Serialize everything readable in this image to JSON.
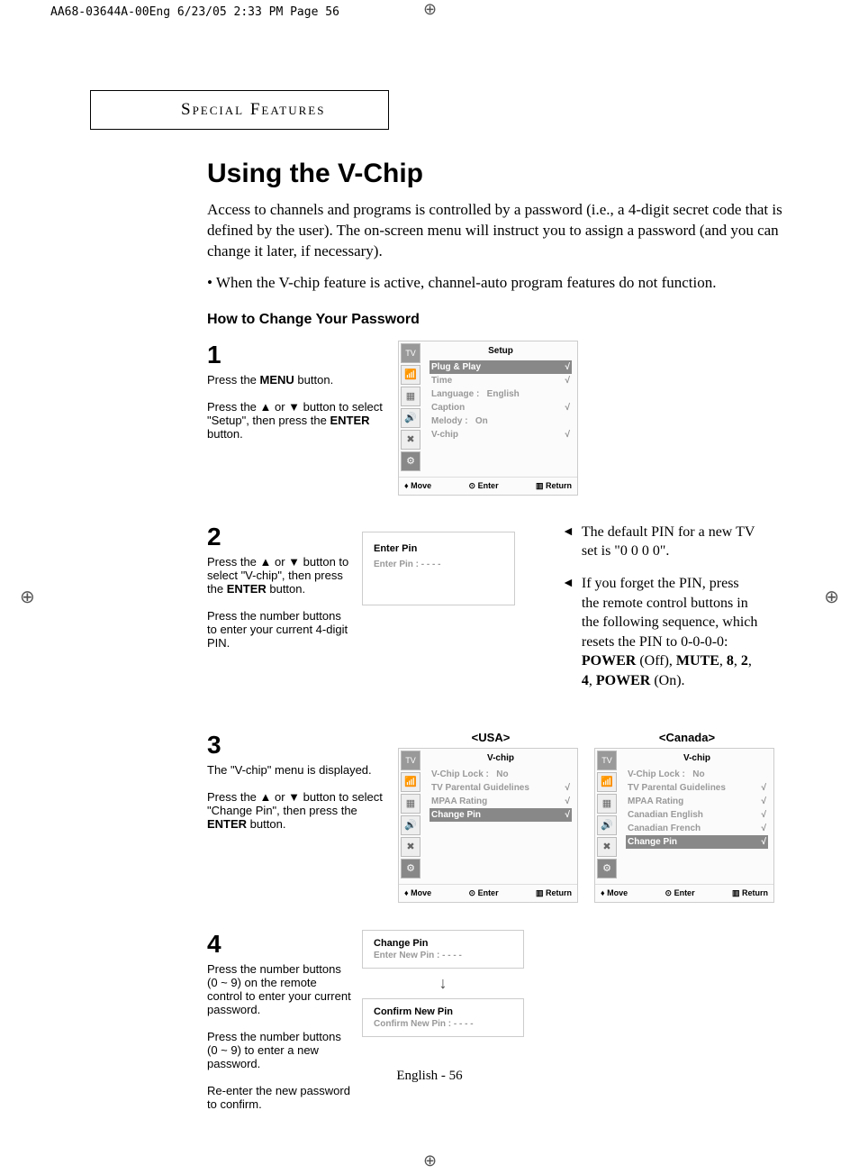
{
  "print_header": "AA68-03644A-00Eng  6/23/05  2:33 PM  Page 56",
  "chapter": "Special Features",
  "title": "Using the V-Chip",
  "intro": "Access to channels and programs is controlled by a password (i.e., a 4-digit secret code that is defined by the user). The on-screen menu will instruct you to assign a password (and you can change it later, if necessary).",
  "bullet1": "•   When the V-chip feature is active, channel-auto program features do not function.",
  "subheading": "How to Change Your Password",
  "steps": {
    "s1": {
      "num": "1",
      "line1_pre": "Press the ",
      "line1_bold": "MENU",
      "line1_post": " button.",
      "line2": "Press the ▲ or ▼ button to select \"Setup\", then press the ",
      "line2_bold": "ENTER",
      "line2_post": " button."
    },
    "s2": {
      "num": "2",
      "line1": "Press the ▲ or ▼ button to select  \"V-chip\", then press the ",
      "line1_bold": "ENTER",
      "line1_post": " button.",
      "line2": "Press the number buttons to enter your current 4-digit PIN."
    },
    "s3": {
      "num": "3",
      "line1": "The \"V-chip\" menu is displayed.",
      "line2": "Press the ▲ or ▼ button to select \"Change Pin\", then press the ",
      "line2_bold": "ENTER",
      "line2_post": " button."
    },
    "s4": {
      "num": "4",
      "line1": "Press the number buttons (0 ~ 9) on the remote control to enter your current password.",
      "line2": "Press the number buttons (0 ~ 9) to enter a new password.",
      "line3": "Re-enter the new password to confirm."
    }
  },
  "osd_setup": {
    "title": "Setup",
    "rows": [
      {
        "label": "Plug & Play",
        "val": "",
        "arr": "√",
        "hl": true
      },
      {
        "label": "Time",
        "val": "",
        "arr": "√"
      },
      {
        "label": "Language :",
        "val": "English",
        "arr": ""
      },
      {
        "label": "Caption",
        "val": "",
        "arr": "√"
      },
      {
        "label": "Melody   :",
        "val": "On",
        "arr": ""
      },
      {
        "label": "V-chip",
        "val": "",
        "arr": "√"
      }
    ],
    "footer": {
      "move": "Move",
      "enter": "Enter",
      "ret": "Return"
    }
  },
  "osd_enterpin": {
    "title": "Enter Pin",
    "line": "Enter Pin               : - - - -"
  },
  "osd_vchip_usa": {
    "header": "<USA>",
    "title": "V-chip",
    "rows": [
      {
        "label": "V-Chip Lock     :",
        "val": "No",
        "arr": ""
      },
      {
        "label": "TV Parental Guidelines",
        "val": "",
        "arr": "√"
      },
      {
        "label": "MPAA Rating",
        "val": "",
        "arr": "√"
      },
      {
        "label": "Change Pin",
        "val": "",
        "arr": "√",
        "hl": true
      }
    ],
    "footer": {
      "move": "Move",
      "enter": "Enter",
      "ret": "Return"
    }
  },
  "osd_vchip_can": {
    "header": "<Canada>",
    "title": "V-chip",
    "rows": [
      {
        "label": "V-Chip Lock     :",
        "val": "No",
        "arr": ""
      },
      {
        "label": "TV Parental Guidelines",
        "val": "",
        "arr": "√"
      },
      {
        "label": "MPAA Rating",
        "val": "",
        "arr": "√"
      },
      {
        "label": "Canadian English",
        "val": "",
        "arr": "√"
      },
      {
        "label": "Canadian French",
        "val": "",
        "arr": "√"
      },
      {
        "label": "Change Pin",
        "val": "",
        "arr": "√",
        "hl": true
      }
    ],
    "footer": {
      "move": "Move",
      "enter": "Enter",
      "ret": "Return"
    }
  },
  "osd_changepin": {
    "title": "Change Pin",
    "line": "Enter New Pin      : - - - -"
  },
  "osd_confirmpin": {
    "title": "Confirm New Pin",
    "line": "Confirm New Pin  : - - - -"
  },
  "notes": {
    "n1": "The default PIN for a new TV set is \"0 0 0 0\".",
    "n2_pre": "If you forget the PIN, press the remote control buttons in the following sequence, which resets the PIN to 0-0-0-0: ",
    "n2_b1": "POWER",
    "n2_mid1": " (Off), ",
    "n2_b2": "MUTE",
    "n2_mid2": ", ",
    "n2_b3": "8",
    "n2_mid3": ", ",
    "n2_b4": "2",
    "n2_mid4": ", ",
    "n2_b5": "4",
    "n2_mid5": ", ",
    "n2_b6": "POWER",
    "n2_post": " (On)."
  },
  "page_num": "English - 56",
  "icons": {
    "tv": "TV",
    "ant": "📶",
    "pic": "▦",
    "snd": "🔊",
    "opt": "✖",
    "set": "⚙"
  }
}
